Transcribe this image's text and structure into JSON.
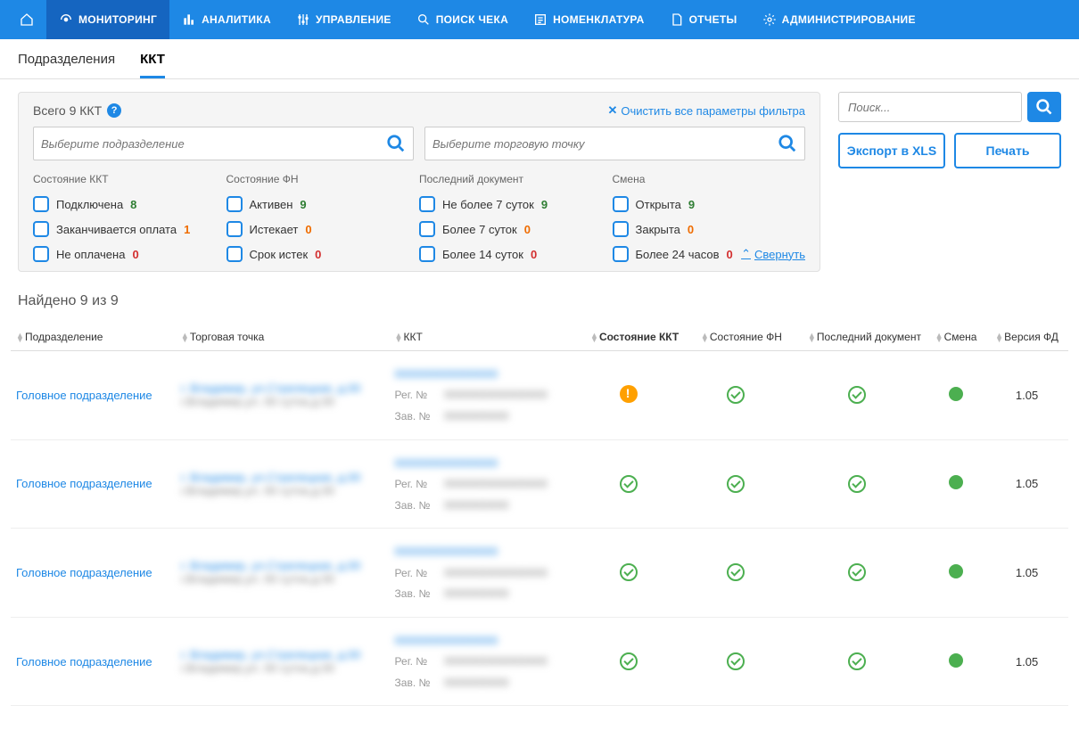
{
  "nav": {
    "items": [
      {
        "label": "МОНИТОРИНГ",
        "active": true
      },
      {
        "label": "АНАЛИТИКА"
      },
      {
        "label": "УПРАВЛЕНИЕ"
      },
      {
        "label": "ПОИСК ЧЕКА"
      },
      {
        "label": "НОМЕНКЛАТУРА"
      },
      {
        "label": "ОТЧЕТЫ"
      },
      {
        "label": "АДМИНИСТРИРОВАНИЕ"
      }
    ]
  },
  "subtabs": {
    "items": [
      {
        "label": "Подразделения"
      },
      {
        "label": "ККТ",
        "active": true
      }
    ]
  },
  "filter": {
    "total": "Всего 9 ККТ",
    "clear": "Очистить все параметры фильтра",
    "dept_placeholder": "Выберите подразделение",
    "point_placeholder": "Выберите торговую точку",
    "collapse": "Свернуть",
    "groups": [
      {
        "title": "Состояние ККТ",
        "items": [
          {
            "label": "Подключена",
            "count": "8",
            "cls": "cnt-g"
          },
          {
            "label": "Заканчивается оплата",
            "count": "1",
            "cls": "cnt-o"
          },
          {
            "label": "Не оплачена",
            "count": "0",
            "cls": "cnt-r"
          }
        ]
      },
      {
        "title": "Состояние ФН",
        "items": [
          {
            "label": "Активен",
            "count": "9",
            "cls": "cnt-g"
          },
          {
            "label": "Истекает",
            "count": "0",
            "cls": "cnt-o"
          },
          {
            "label": "Срок истек",
            "count": "0",
            "cls": "cnt-r"
          }
        ]
      },
      {
        "title": "Последний документ",
        "items": [
          {
            "label": "Не более 7 суток",
            "count": "9",
            "cls": "cnt-g"
          },
          {
            "label": "Более 7 суток",
            "count": "0",
            "cls": "cnt-o"
          },
          {
            "label": "Более 14 суток",
            "count": "0",
            "cls": "cnt-r"
          }
        ]
      },
      {
        "title": "Смена",
        "items": [
          {
            "label": "Открыта",
            "count": "9",
            "cls": "cnt-g"
          },
          {
            "label": "Закрыта",
            "count": "0",
            "cls": "cnt-o"
          },
          {
            "label": "Более 24 часов",
            "count": "0",
            "cls": "cnt-r"
          }
        ]
      }
    ]
  },
  "right": {
    "search_placeholder": "Поиск...",
    "export": "Экспорт в XLS",
    "print": "Печать"
  },
  "found": "Найдено 9 из 9",
  "table": {
    "headers": {
      "dept": "Подразделение",
      "point": "Торговая точка",
      "kkt": "ККТ",
      "sost_kkt": "Состояние ККТ",
      "sost_fn": "Состояние ФН",
      "last_doc": "Последний документ",
      "shift": "Смена",
      "ver": "Версия ФД"
    },
    "reg_label": "Рег. №",
    "zav_label": "Зав. №",
    "rows": [
      {
        "dept": "Головное подразделение",
        "kkt_status": "warn",
        "ver": "1.05"
      },
      {
        "dept": "Головное подразделение",
        "kkt_status": "ok",
        "ver": "1.05"
      },
      {
        "dept": "Головное подразделение",
        "kkt_status": "ok",
        "ver": "1.05"
      },
      {
        "dept": "Головное подразделение",
        "kkt_status": "ok",
        "ver": "1.05"
      }
    ]
  }
}
